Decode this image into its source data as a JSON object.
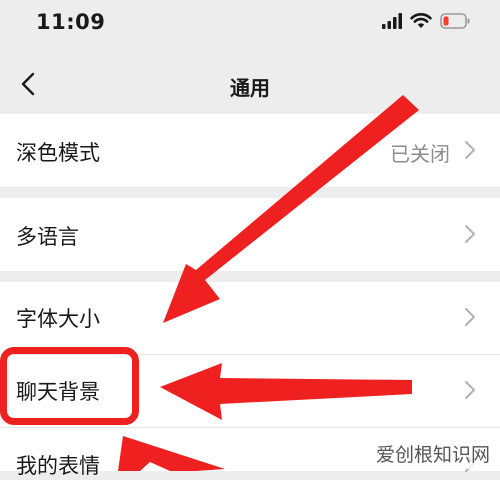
{
  "status": {
    "time": "11:09"
  },
  "nav": {
    "title": "通用"
  },
  "items": [
    {
      "label": "深色模式",
      "value": "已关闭"
    },
    {
      "label": "多语言"
    },
    {
      "label": "字体大小"
    },
    {
      "label": "聊天背景"
    },
    {
      "label": "我的表情"
    }
  ],
  "watermark": "爱创根知识网",
  "colors": {
    "accent": "#ef2020",
    "background": "#ededed",
    "row": "#ffffff"
  }
}
